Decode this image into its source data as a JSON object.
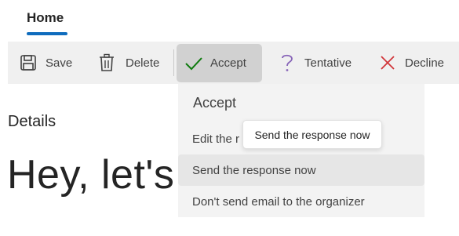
{
  "ribbon": {
    "active_tab": "Home"
  },
  "toolbar": {
    "save_label": "Save",
    "delete_label": "Delete",
    "accept_label": "Accept",
    "tentative_label": "Tentative",
    "decline_label": "Decline",
    "icons": {
      "save": "save-icon",
      "delete": "trash-icon",
      "accept": "checkmark-icon",
      "tentative": "question-mark-icon",
      "decline": "x-icon"
    }
  },
  "content": {
    "details_label": "Details",
    "body_preview": "Hey, let's m"
  },
  "accept_menu": {
    "title": "Accept",
    "items": [
      {
        "label": "Edit the r"
      },
      {
        "label": "Send the response now"
      },
      {
        "label": "Don't send email to the organizer"
      }
    ]
  },
  "tooltip": {
    "text": "Send the response now"
  },
  "colors": {
    "accent": "#0f6cbd",
    "accept_check": "#107c10",
    "tentative": "#8764b8",
    "decline": "#d13438"
  }
}
